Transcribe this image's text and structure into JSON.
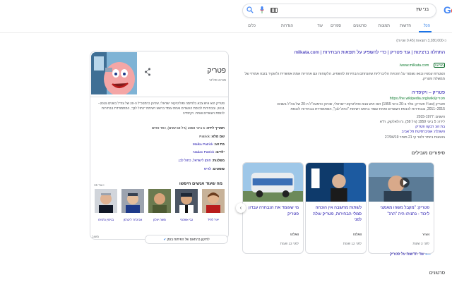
{
  "header": {
    "logo_part1": "G",
    "logo_part2": "o",
    "search_query": "בני שץ",
    "tabs": [
      {
        "label": "הכל",
        "active": true
      },
      {
        "label": "חדשות"
      },
      {
        "label": "תמונות"
      },
      {
        "label": "סרטונים"
      },
      {
        "label": "ספרים"
      },
      {
        "label": "עוד"
      },
      {
        "label": "הגדרות"
      },
      {
        "label": "כלים"
      }
    ],
    "result_stats": "כ-3,280,000 תוצאות (0.45 שניות)"
  },
  "results": [
    {
      "title": "התחלה ברצינות | גנד פטריק | כדי להשפיע על תוצאות הבחירות | milkata.com",
      "url": "www.milkata.com/",
      "badge": "מודעה",
      "snippet": "הצטרפו עכשיו ובואו נשמור על הזכויות הליברליות שהנחתם הבחירות להשפיע. הלקוחות עם אחריות אמת אפשרית ולהוקיר בזבוז אמיתי של ממשלת פטריק."
    },
    {
      "title": "פטריק – ויקיפדיה",
      "url": "https://he.wikipedia.org/wiki/פטריק",
      "snippet_lines": [
        "פטריק (אנג'ל פטריק; נולד ב-20 ביוני 1955) הוא איש צבא ופוליטיקאי ישראלי, שכיהן כרמטכ\"ל ה-20 של צה\"ל בשנים",
        "2015–2011, ובבחירות לכנסת העשרים ואחת עומד בראש רשימת \"כחול לבן\", המתמודדת בבחירות לכנסת",
        "השנים: 2015-1977",
        "לידה: 5 ביוני 1959 (גיל 59), ג'ו ולאלקוק, ת\"א",
        "בת זוג: רבקה פטריק",
        "השכלה: אוניברסיטת תל אביב"
      ],
      "meta": "בוטעות ביותר זלצר קי 21 מותר 27/04/19"
    }
  ],
  "top_stories": {
    "title": "סיפורים מובילים",
    "cards": [
      {
        "text": "פטריק: \"מקבל משהו מאמצי ליכוד - נתניהו היה \"הרג\"",
        "source": "Ynet",
        "time": "לפני 3 שעות"
      },
      {
        "text": "לשתות מחשבה אין הוכחה סמלי הבחירות, פטריק עולה לפני",
        "source": "וואלה!",
        "time": "לפני 12 שעות"
      },
      {
        "text": "מי שעומד את הנבחרה עבדון פטריק",
        "source": "וואלה!",
        "time": "לפני 13 שעות"
      }
    ],
    "more_news": "עוד חדשות על פטריק"
  },
  "bottom_section_title": "סרטונים",
  "knowledge_panel": {
    "title": "פטריק",
    "subtitle": "מנהיג פוליטי",
    "description": "פטריק הוא איש צבא בלחימה ופוליטיקאי ישראלי, שכיהן כרמטכ\"ל ה-20 של צה\"ל בשנים 2015–2011, ובבחירות לכנסת העשרים ואחת עומד בראש רשימת \"כחול לבן\", המתמודדת בבחירות לכנסת העשרים ואחת. ויקיפדיה",
    "facts": [
      {
        "key": "תאריך לידה:",
        "value": "5 ביוני 1959 (גיל 59 שנים), כפר אחים"
      },
      {
        "key": "שם מלא:",
        "value": "Patrick"
      },
      {
        "key": "בת זוג:",
        "value": "Malka Patrick"
      },
      {
        "key": "ילדים:",
        "value": "Nadav Patrick"
      },
      {
        "key": "מפלגות:",
        "value": "חוסן לישראל, כחול לבן"
      },
      {
        "key": "פוסטים:",
        "value": "לגייס"
      }
    ],
    "more_label": "מה שעוד אנשים חיפשו",
    "more_count": "עוד 15+",
    "people": [
      {
        "name": "יאיר לפיד"
      },
      {
        "name": "גבי אשכנזי"
      },
      {
        "name": "משה יעלון"
      },
      {
        "name": "אביגדור ליברמן"
      },
      {
        "name": "בנימין נתניהו"
      }
    ],
    "feedback_button": "לתיקון בהתאם של הפיתוח בזמן",
    "feedback_link": "משוב"
  },
  "colors": {
    "link": "#1a0dab",
    "url": "#188038",
    "accent": "#1a73e8"
  }
}
